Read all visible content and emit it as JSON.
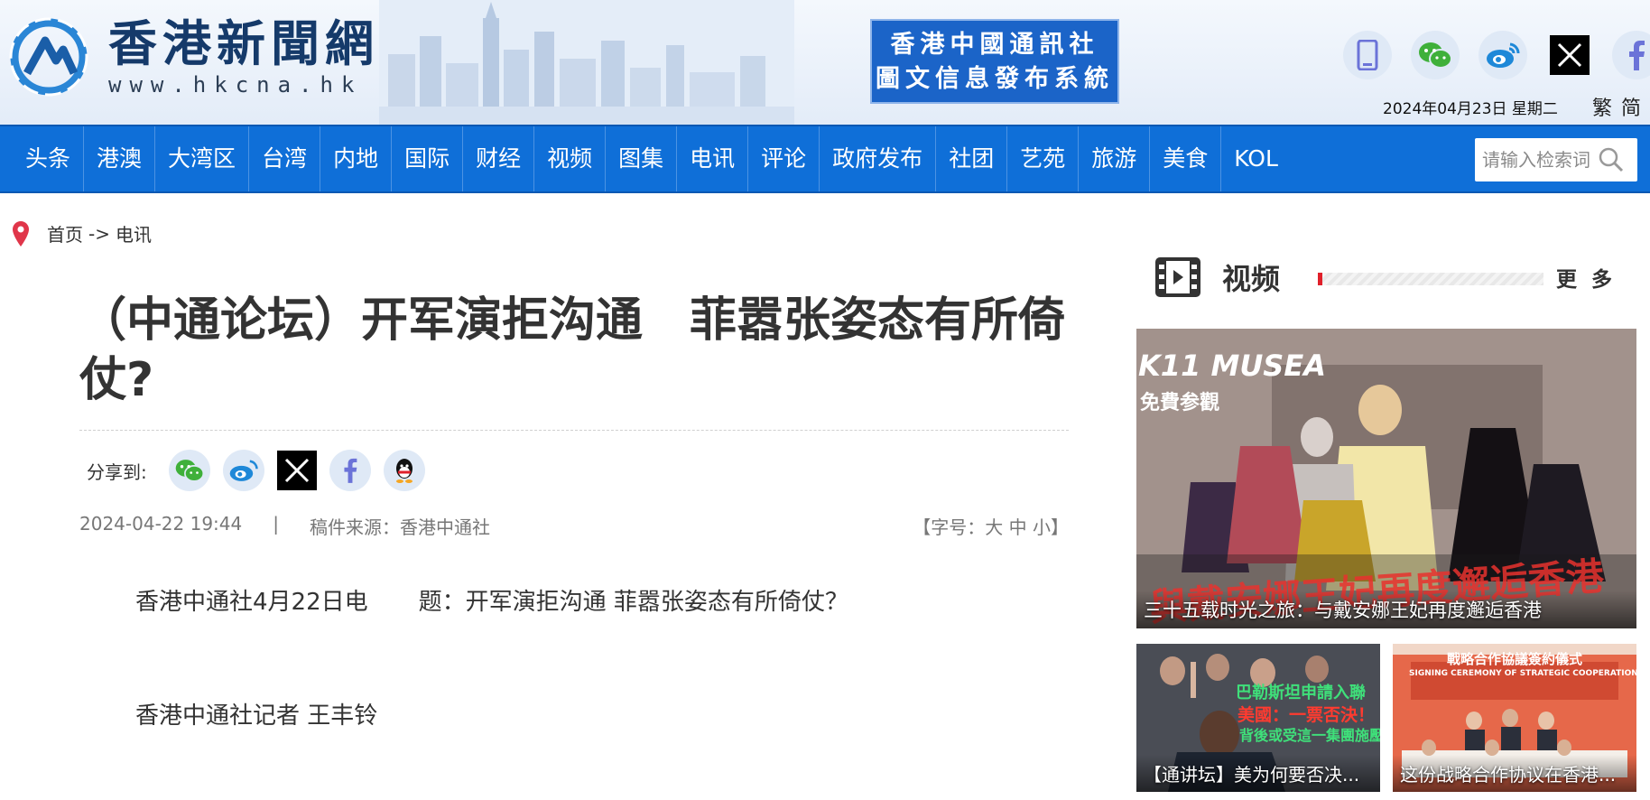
{
  "header": {
    "logo_cn": "香港新聞網",
    "logo_url": "www.hkcna.hk",
    "promo_line1": "香港中國通訊社",
    "promo_line2": "圖文信息發布系統",
    "date": "2024年04月23日 星期二",
    "lang_trad": "繁",
    "lang_simp": "简",
    "social_icons": [
      "mobile-icon",
      "wechat-icon",
      "weibo-icon",
      "x-icon",
      "facebook-icon"
    ]
  },
  "nav": {
    "items": [
      "头条",
      "港澳",
      "大湾区",
      "台湾",
      "内地",
      "国际",
      "财经",
      "视频",
      "图集",
      "电讯",
      "评论",
      "政府发布",
      "社团",
      "艺苑",
      "旅游",
      "美食",
      "KOL"
    ],
    "search_placeholder": "请输入检索词"
  },
  "breadcrumb": {
    "home": "首页",
    "arrow": "->",
    "current": "电讯"
  },
  "article": {
    "title": "（中通论坛）开军演拒沟通　菲嚣张姿态有所倚仗?",
    "share_label": "分享到:",
    "share_icons": [
      "wechat-icon",
      "weibo-icon",
      "x-icon",
      "facebook-icon",
      "qq-icon"
    ],
    "datetime": "2024-04-22 19:44",
    "separator": "|",
    "source": "稿件来源：香港中通社",
    "font_size": "【字号：大 中 小】",
    "dateline": "香港中通社4月22日电",
    "headline": "题：开军演拒沟通 菲嚣张姿态有所倚仗？",
    "byline": "香港中通社记者 王丰铃"
  },
  "sidebar": {
    "section_title": "视频",
    "more": "更 多",
    "big_video": {
      "caption": "三十五载时光之旅：与戴安娜王妃再度邂逅香港",
      "overlay_top": "K11 MUSEA",
      "overlay_sub": "免費参觀",
      "overlay_bottom": "與戴安娜王妃再度邂逅香港"
    },
    "small_videos": [
      {
        "caption": "【通讲坛】美为何要否决...",
        "overlay_1": "巴勒斯坦申請入聯",
        "overlay_2": "美國：一票否決！",
        "overlay_3": "背後或受這一集團施壓"
      },
      {
        "caption": "这份战略合作协议在香港...",
        "overlay_1": "戰略合作協議簽約儀式",
        "overlay_2": "SIGNING CEREMONY OF STRATEGIC COOPERATION AGREEMENT"
      }
    ]
  },
  "colors": {
    "nav_blue": "#0f6fd8",
    "promo_blue": "#1b64c8",
    "logo_navy": "#153a6a",
    "accent_red": "#e0202a"
  }
}
